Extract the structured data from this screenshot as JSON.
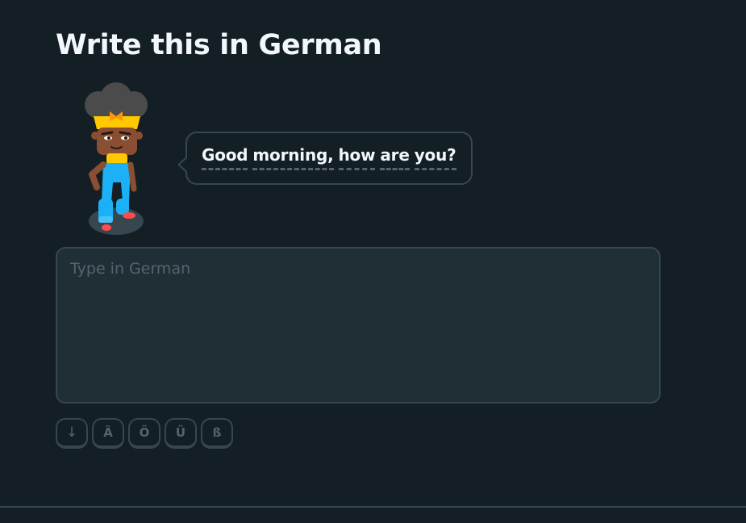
{
  "page": {
    "title": "Write this in German"
  },
  "prompt": {
    "words": [
      "Good",
      "morning,",
      "how",
      "are",
      "you?"
    ]
  },
  "answer": {
    "placeholder": "Type in German",
    "value": ""
  },
  "keyboard": {
    "keys": [
      "↓",
      "Ä",
      "Ö",
      "Ü",
      "ß"
    ]
  },
  "colors": {
    "background": "#141e25",
    "border": "#37464f",
    "input_background": "#202f36",
    "text": "#f1f7fb",
    "muted": "#52656d"
  },
  "icons": {
    "character": "character-avatar-icon",
    "collapse_key": "arrow-down-icon"
  }
}
